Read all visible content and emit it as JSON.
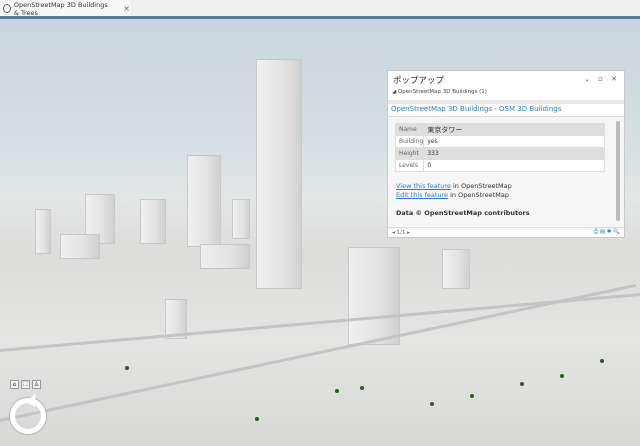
{
  "tab": {
    "title": "OpenStreetMap 3D Buildings & Trees",
    "close": "×",
    "icon": "globe-icon"
  },
  "popup": {
    "title": "ポップアップ",
    "controls": "⌄ ▫ ✕",
    "layer": "◢ OpenStreetMap 3D Buildings (1)",
    "heading": "OpenStreetMap 3D Buildings - OSM 3D Buildings",
    "rows": [
      {
        "k": "Name",
        "v": "東京タワー"
      },
      {
        "k": "Building",
        "v": "yes"
      },
      {
        "k": "Height",
        "v": "333"
      },
      {
        "k": "Levels",
        "v": "0"
      }
    ],
    "link1": "View this feature",
    "link1_suffix": " in OpenStreetMap",
    "link2": "Edit this feature",
    "link2_suffix": " in OpenStreetMap",
    "credit": "Data © OpenStreetMap contributors",
    "pager": "◂ 1/1 ▸",
    "footer_icons": "⎙ ▤ ✱ 🔍"
  },
  "nav": {
    "b1": "⌂",
    "b2": "⛶",
    "b3": "♙",
    "compass": "compass-icon"
  }
}
